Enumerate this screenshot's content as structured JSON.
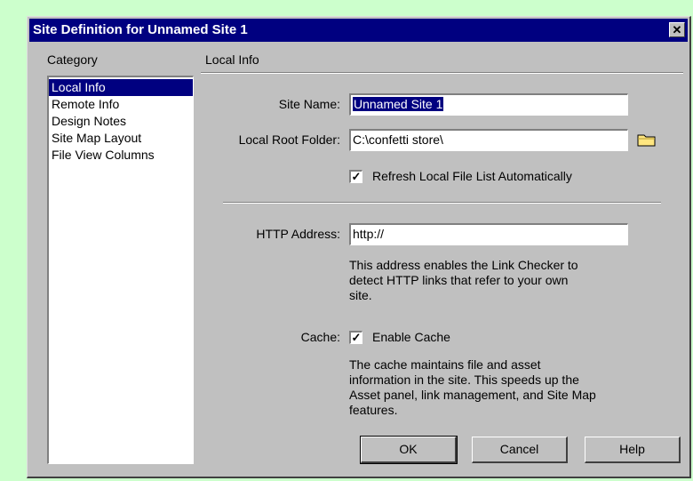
{
  "window": {
    "title": "Site Definition for Unnamed Site 1",
    "close_glyph": "✕"
  },
  "category": {
    "header": "Category",
    "items": [
      "Local Info",
      "Remote Info",
      "Design Notes",
      "Site Map Layout",
      "File View Columns"
    ],
    "selected": "Local Info"
  },
  "panel": {
    "header": "Local Info",
    "site_name_label": "Site Name:",
    "site_name_value": "Unnamed Site 1",
    "local_root_label": "Local Root Folder:",
    "local_root_value": "C:\\confetti store\\",
    "folder_icon": "folder-icon",
    "refresh_label": "Refresh Local File List Automatically",
    "refresh_checked": "✓",
    "http_label": "HTTP Address:",
    "http_value": "http://",
    "http_desc_1": "This address enables the Link Checker to",
    "http_desc_2": "detect HTTP links that refer to your own",
    "http_desc_3": "site.",
    "cache_label": "Cache:",
    "cache_checkbox_label": "Enable Cache",
    "cache_checked": "✓",
    "cache_desc_1": "The cache maintains file and asset",
    "cache_desc_2": "information in the site.  This speeds up the",
    "cache_desc_3": "Asset panel, link management, and Site Map",
    "cache_desc_4": "features."
  },
  "buttons": {
    "ok": "OK",
    "cancel": "Cancel",
    "help": "Help"
  },
  "colors": {
    "background": "#ccffcc",
    "dialog": "#c0c0c0",
    "titlebar": "#000080"
  }
}
